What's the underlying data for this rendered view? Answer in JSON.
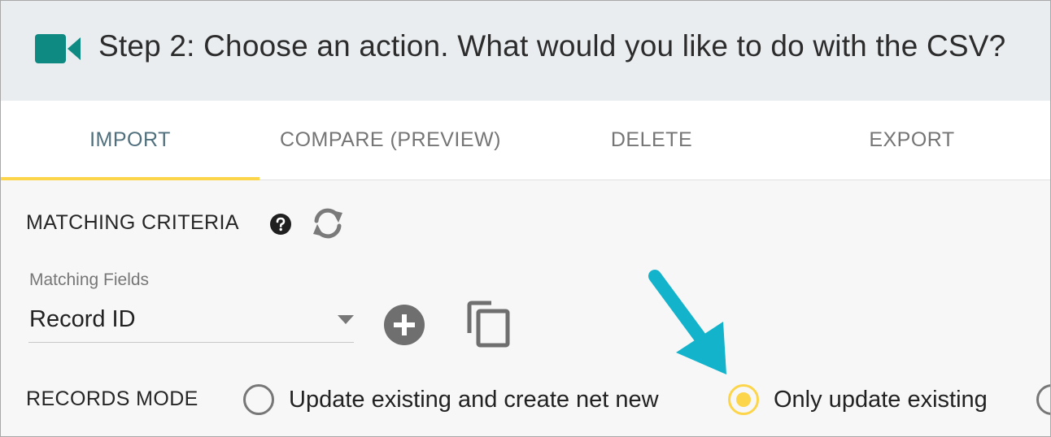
{
  "header": {
    "title": "Step 2: Choose an action. What would you like to do with the CSV?",
    "icon": "video-camera-icon",
    "icon_color": "#0e8a82"
  },
  "tabs": [
    {
      "label": "IMPORT",
      "active": true
    },
    {
      "label": "COMPARE (PREVIEW)",
      "active": false
    },
    {
      "label": "DELETE",
      "active": false
    },
    {
      "label": "EXPORT",
      "active": false
    }
  ],
  "matching": {
    "title": "MATCHING CRITERIA",
    "help_icon": "help-icon",
    "refresh_icon": "refresh-icon",
    "field_label": "Matching Fields",
    "field_value": "Record ID",
    "add_icon": "add-circle-icon",
    "copy_icon": "copy-icon"
  },
  "records_mode": {
    "label": "RECORDS MODE",
    "options": [
      {
        "label": "Update existing and create net new",
        "selected": false
      },
      {
        "label": "Only update existing",
        "selected": true
      },
      {
        "label": "",
        "selected": false
      }
    ]
  },
  "colors": {
    "accent": "#fdd54a",
    "annotation_arrow": "#14b3cc",
    "active_tab_text": "#50707d"
  }
}
